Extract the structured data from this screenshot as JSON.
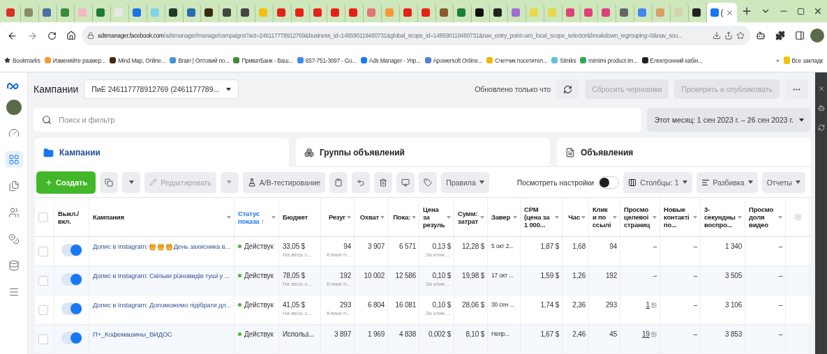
{
  "browser": {
    "tabs": [
      {
        "color": "#d93025",
        "selected": false
      },
      {
        "color": "#8a8a6a",
        "selected": false
      },
      {
        "color": "#4a6fa5",
        "selected": false
      },
      {
        "color": "#3b8b3b",
        "selected": false
      },
      {
        "color": "#f2b8c6",
        "selected": false
      },
      {
        "color": "#1e7a3a",
        "selected": false
      },
      {
        "color": "#e8e8e8",
        "selected": false
      },
      {
        "color": "#1a73e8",
        "selected": false
      },
      {
        "color": "#7fd3e8",
        "selected": false
      },
      {
        "color": "#1f3a2a",
        "selected": false
      },
      {
        "color": "#2b6cb0",
        "selected": false
      },
      {
        "color": "#3a2a10",
        "selected": false
      },
      {
        "color": "#444444",
        "selected": false
      },
      {
        "color": "#444444",
        "selected": false
      },
      {
        "color": "#f4c20d",
        "selected": false
      },
      {
        "color": "#e62117",
        "selected": false
      },
      {
        "color": "#e62117",
        "selected": false
      },
      {
        "color": "#e62117",
        "selected": false
      },
      {
        "color": "#e62117",
        "selected": false
      },
      {
        "color": "#e62117",
        "selected": false
      },
      {
        "color": "#e57373",
        "selected": false
      },
      {
        "color": "#f29b38",
        "selected": false
      },
      {
        "color": "#e62117",
        "selected": false
      },
      {
        "color": "#e62117",
        "selected": false
      },
      {
        "color": "#8b5a2b",
        "selected": false
      },
      {
        "color": "#1b7f3b",
        "selected": false
      },
      {
        "color": "#111111",
        "selected": false
      },
      {
        "color": "#222222",
        "selected": false
      },
      {
        "color": "#9b6fd6",
        "selected": false
      },
      {
        "color": "#e6d84a",
        "selected": false
      },
      {
        "color": "#e6d84a",
        "selected": false
      },
      {
        "color": "#e0407a",
        "selected": false
      },
      {
        "color": "#e0407a",
        "selected": false
      },
      {
        "color": "#e0407a",
        "selected": false
      },
      {
        "color": "#666666",
        "selected": false
      },
      {
        "color": "#4285f4",
        "selected": false
      },
      {
        "color": "#d9a066",
        "selected": false
      },
      {
        "color": "#d8d0b0",
        "selected": false
      },
      {
        "color": "#222222",
        "selected": false
      },
      {
        "color": "#1877f2",
        "selected": true,
        "title": "("
      }
    ],
    "url_host": "adsmanager.facebook.com",
    "url_path": "/adsmanager/manage/campaigns?act=246117778912769&business_id=148590119480731&global_scope_id=148590119480731&nav_entry_point=am_local_scope_selector&breakdown_regrouping=0&nav_sou...",
    "bookmarks": [
      {
        "kind": "star",
        "color": "#333333",
        "label": "Bookmarks"
      },
      {
        "kind": "favicon",
        "color": "#f29b38",
        "label": "Изменяйте размер..."
      },
      {
        "kind": "favicon",
        "color": "#3a2a10",
        "label": "Mind Map, Online..."
      },
      {
        "kind": "favicon",
        "color": "#4a90d9",
        "label": "Brain | Оптовий по..."
      },
      {
        "kind": "favicon",
        "color": "#3b8b3b",
        "label": "ПриватБанк - Ваш..."
      },
      {
        "kind": "favicon",
        "color": "#4285f4",
        "label": "657-751-3097 - Go..."
      },
      {
        "kind": "favicon",
        "color": "#1877f2",
        "label": "Ads Manager - Упр..."
      },
      {
        "kind": "favicon",
        "color": "#5a7fd6",
        "label": "Apowersoft Online..."
      },
      {
        "kind": "favicon",
        "color": "#f4b400",
        "label": "Счетчик посетител..."
      },
      {
        "kind": "favicon",
        "color": "#5bc0de",
        "label": "Sitniks"
      },
      {
        "kind": "favicon",
        "color": "#34a853",
        "label": "mimimi product im..."
      },
      {
        "kind": "favicon",
        "color": "#222222",
        "label": "Електронний кабін..."
      }
    ],
    "more": "»",
    "all_bookmarks": "Все закладк"
  },
  "sidebar": {
    "items": [
      {
        "kind": "gauge",
        "selected": false
      },
      {
        "kind": "grid",
        "selected": true
      },
      {
        "kind": "pages",
        "selected": false
      },
      {
        "kind": "people",
        "selected": false
      },
      {
        "kind": "coins",
        "selected": false
      },
      {
        "kind": "stack",
        "selected": false
      },
      {
        "kind": "menu",
        "selected": false
      }
    ]
  },
  "header": {
    "title": "Кампании",
    "account": "ПиЕ 246117778912769 (2461177789...",
    "updated": "Обновлено только что",
    "discard": {
      "label": "Сбросить черновики",
      "disabled": true
    },
    "publish": {
      "label": "Проверить и опубликовать",
      "disabled": true
    }
  },
  "search": {
    "placeholder": "Поиск и фильтр"
  },
  "date_range": "Этот месяц: 1 сен 2023 г. – 26 сен 2023 г.",
  "level_tabs": [
    {
      "kind": "folder",
      "label": "Кампании",
      "selected": true
    },
    {
      "kind": "groups",
      "label": "Группы объявлений",
      "selected": false
    },
    {
      "kind": "page",
      "label": "Объявления",
      "selected": false
    }
  ],
  "toolbar": {
    "create": "Создать",
    "edit": {
      "label": "Редактировать",
      "disabled": true
    },
    "ab_test": "A/B-тестирование",
    "rules": "Правила",
    "view_settings": {
      "label": "Посмотреть настройки",
      "on": false
    },
    "columns": "Столбцы: 1",
    "breakdown": "Разбивка",
    "reports": "Отчеты"
  },
  "table": {
    "columns": [
      {
        "kind": "select",
        "checked": false
      },
      {
        "label": "Выкл./ вкл.",
        "sorted": false
      },
      {
        "label": "Кампания",
        "sorted": false
      },
      {
        "label": "Статус показа ↑",
        "sorted": true
      },
      {
        "label": "Бюджет",
        "sorted": false
      },
      {
        "label": "Резуг",
        "sorted": false
      },
      {
        "label": "Охват",
        "sorted": false
      },
      {
        "label": "Пока:",
        "sorted": false
      },
      {
        "label": "Цена за резуль",
        "sorted": false
      },
      {
        "label": "Сумм: затрат",
        "sorted": false
      },
      {
        "label": "Завер",
        "sorted": false
      },
      {
        "label": "CPM (цена за 1 000...",
        "sorted": false
      },
      {
        "label": "Час",
        "sorted": false
      },
      {
        "label": "Клики по ссылі",
        "sorted": false
      },
      {
        "label": "Просмо целевоі страниц",
        "sorted": false
      },
      {
        "label": "Новые контакті по...",
        "sorted": false
      },
      {
        "label": "3- секундны воспро...",
        "sorted": false
      },
      {
        "label": "Просмо доля видео",
        "sorted": false
      }
    ],
    "rows": [
      {
        "cells": [
          {
            "kind": "checkbox",
            "checked": false
          },
          {
            "kind": "toggle",
            "on": true
          },
          {
            "kind": "campaign",
            "name": "Допис в Instagram:",
            "name_icons": [
              {
                "kind": "gift"
              },
              {
                "kind": "gift"
              },
              {
                "kind": "gift"
              }
            ],
            "name_after": "День захисника в..."
          },
          {
            "kind": "status",
            "value": "Действук"
          },
          {
            "value": "33,05 $",
            "sub": "На весь с..."
          },
          {
            "value": "94",
            "sub": "Клики п..."
          },
          {
            "value": "3 907"
          },
          {
            "value": "6 571"
          },
          {
            "value": "0,13 $",
            "sub": "За клик ..."
          },
          {
            "value": "12,28 $"
          },
          {
            "value": "5 окт 2..."
          },
          {
            "value": "1,87 $"
          },
          {
            "value": "1,68"
          },
          {
            "value": "94"
          },
          {
            "value": "–"
          },
          {
            "value": "–"
          },
          {
            "value": "1 340"
          },
          {
            "value": "–"
          }
        ]
      },
      {
        "cells": [
          {
            "kind": "checkbox",
            "checked": false
          },
          {
            "kind": "toggle",
            "on": true
          },
          {
            "kind": "campaign",
            "name": "Допис в Instagram: Скільки різновидів туші у ..."
          },
          {
            "kind": "status",
            "value": "Действук"
          },
          {
            "value": "78,05 $",
            "sub": "На весь с..."
          },
          {
            "value": "192",
            "sub": "Клики п..."
          },
          {
            "value": "10 002"
          },
          {
            "value": "12 586"
          },
          {
            "value": "0,10 $",
            "sub": "За клик ..."
          },
          {
            "value": "19,98 $"
          },
          {
            "value": "17 окт ..."
          },
          {
            "value": "1,59 $"
          },
          {
            "value": "1,26"
          },
          {
            "value": "192"
          },
          {
            "value": "–"
          },
          {
            "value": "–"
          },
          {
            "value": "3 505"
          },
          {
            "value": "–"
          }
        ]
      },
      {
        "cells": [
          {
            "kind": "checkbox",
            "checked": false
          },
          {
            "kind": "toggle",
            "on": true
          },
          {
            "kind": "campaign",
            "name": "Допис в Instagram: Допоможемо підібрати дл..."
          },
          {
            "kind": "status",
            "value": "Действук"
          },
          {
            "value": "41,05 $",
            "sub": "На весь с..."
          },
          {
            "value": "293",
            "sub": "Клики п..."
          },
          {
            "value": "6 804"
          },
          {
            "value": "16 081"
          },
          {
            "value": "0,10 $",
            "sub": "За клик ..."
          },
          {
            "value": "28,06 $"
          },
          {
            "value": "30 сен ..."
          },
          {
            "value": "1,74 $"
          },
          {
            "value": "2,36"
          },
          {
            "value": "293"
          },
          {
            "value": "1",
            "link": true
          },
          {
            "value": "–"
          },
          {
            "value": "3 106"
          },
          {
            "value": "–"
          }
        ]
      },
      {
        "cells": [
          {
            "kind": "checkbox",
            "checked": false
          },
          {
            "kind": "toggle",
            "on": true
          },
          {
            "kind": "campaign",
            "name": "П+_Кофемашины_ВИДОС"
          },
          {
            "kind": "status",
            "value": "Действук"
          },
          {
            "value": "Использ..."
          },
          {
            "value": "3 897"
          },
          {
            "value": "1 969"
          },
          {
            "value": "4 838"
          },
          {
            "value": "0,002 $"
          },
          {
            "value": "8,10 $"
          },
          {
            "value": "Непр..."
          },
          {
            "value": "1,67 $"
          },
          {
            "value": "2,46"
          },
          {
            "value": "45"
          },
          {
            "value": "19",
            "link": true
          },
          {
            "value": "–"
          },
          {
            "value": "3 853"
          },
          {
            "value": "–"
          }
        ]
      }
    ]
  }
}
